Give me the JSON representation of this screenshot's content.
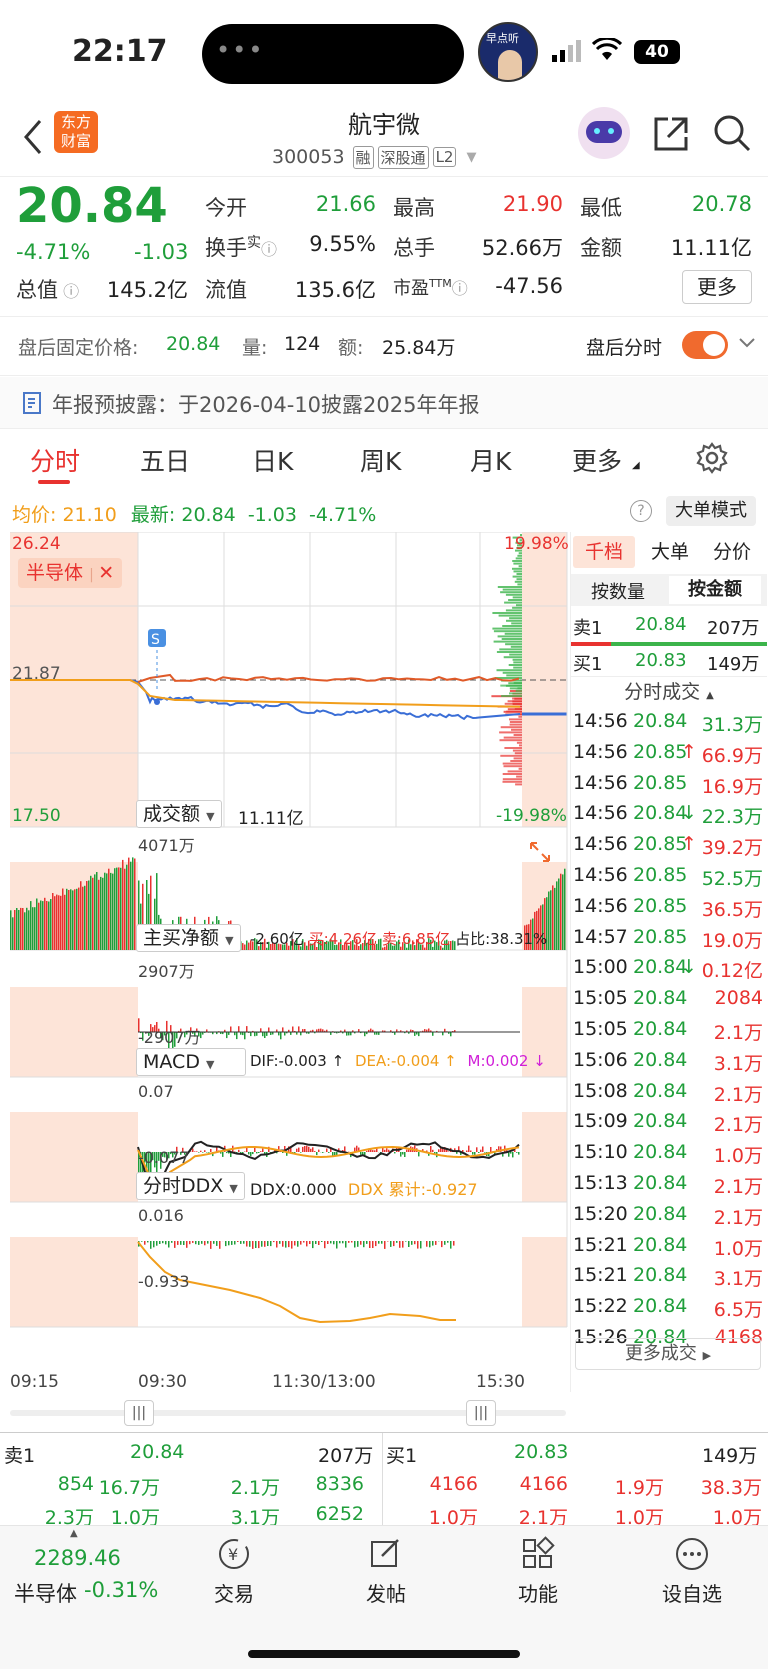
{
  "status": {
    "time": "22:17",
    "battery": "40",
    "listen_badge": "早点听"
  },
  "header": {
    "title": "航宇微",
    "code": "300053",
    "tags": [
      "融",
      "深股通",
      "L2"
    ],
    "logo_line1": "东方",
    "logo_line2": "财富"
  },
  "quote": {
    "price": "20.84",
    "change_pct": "-4.71%",
    "change": "-1.03",
    "open_label": "今开",
    "open": "21.66",
    "high_label": "最高",
    "high": "21.90",
    "low_label": "最低",
    "low": "20.78",
    "turnover_label": "换手",
    "turnover_sup": "实",
    "turnover": "9.55%",
    "volume_label": "总手",
    "volume": "52.66万",
    "amount_label": "金额",
    "amount": "11.11亿",
    "mktcap_label": "总值",
    "mktcap": "145.2亿",
    "float_label": "流值",
    "float": "135.6亿",
    "pe_label": "市盈",
    "pe_sup": "TTM",
    "pe": "-47.56",
    "more": "更多"
  },
  "after": {
    "price_label": "盘后固定价格:",
    "price": "20.84",
    "vol_label": "量:",
    "vol": "124",
    "amt_label": "额:",
    "amt": "25.84万",
    "toggle_label": "盘后分时"
  },
  "notice": {
    "text": "年报预披露：于2026-04-10披露2025年年报"
  },
  "tabs": [
    "分时",
    "五日",
    "日K",
    "周K",
    "月K",
    "更多"
  ],
  "chart": {
    "avg_label": "均价:",
    "avg": "21.10",
    "latest_label": "最新:",
    "latest": "20.84",
    "chg": "-1.03",
    "pct": "-4.71%",
    "big_mode": "大单模式",
    "y_top": "26.24",
    "y_mid": "21.87",
    "y_bot": "17.50",
    "pct_top": "19.98%",
    "pct_bot": "-19.98%",
    "sector_tag": "半导体",
    "vol_label": "成交额",
    "vol_total": "11.11亿",
    "vol_max": "4071万",
    "net_label": "主买净额",
    "net_value": "-2.60亿",
    "net_buy": "买:4.26亿",
    "net_sell": "卖:6.85亿",
    "net_ratio": "占比:38.31%",
    "net_top": "2907万",
    "net_bot": "-2907万",
    "macd_label": "MACD",
    "dif": "DIF:-0.003 ↑",
    "dea": "DEA:-0.004 ↑",
    "m": "M:0.002 ↓",
    "macd_top": "0.07",
    "macd_bot": "-0.077",
    "ddx_label": "分时DDX",
    "ddx": "DDX:0.000",
    "ddx_cum": "DDX 累计:-0.927",
    "ddx_top": "0.016",
    "ddx_bot": "-0.933",
    "x_labels": [
      "09:15",
      "09:30",
      "11:30/13:00",
      "15:30"
    ]
  },
  "right": {
    "tabs": [
      "千档",
      "大单",
      "分价"
    ],
    "sub": [
      "按数量",
      "按金额"
    ],
    "sell1_label": "卖1",
    "sell1_price": "20.84",
    "sell1_amt": "207万",
    "buy1_label": "买1",
    "buy1_price": "20.83",
    "buy1_amt": "149万",
    "trades_title": "分时成交",
    "more": "更多成交",
    "trades": [
      [
        "14:56",
        "20.84",
        "",
        "31.3万",
        "g"
      ],
      [
        "14:56",
        "20.85",
        "↑",
        "66.9万",
        "r"
      ],
      [
        "14:56",
        "20.85",
        "",
        "16.9万",
        "r"
      ],
      [
        "14:56",
        "20.84",
        "↓",
        "22.3万",
        "g"
      ],
      [
        "14:56",
        "20.85",
        "↑",
        "39.2万",
        "r"
      ],
      [
        "14:56",
        "20.85",
        "",
        "52.5万",
        "g"
      ],
      [
        "14:56",
        "20.85",
        "",
        "36.5万",
        "r"
      ],
      [
        "14:57",
        "20.85",
        "",
        "19.0万",
        "r"
      ],
      [
        "15:00",
        "20.84",
        "↓",
        "0.12亿",
        "r"
      ],
      [
        "15:05",
        "20.84",
        "",
        "2084",
        "r"
      ],
      [
        "15:05",
        "20.84",
        "",
        "2.1万",
        "r"
      ],
      [
        "15:06",
        "20.84",
        "",
        "3.1万",
        "r"
      ],
      [
        "15:08",
        "20.84",
        "",
        "2.1万",
        "r"
      ],
      [
        "15:09",
        "20.84",
        "",
        "2.1万",
        "r"
      ],
      [
        "15:10",
        "20.84",
        "",
        "1.0万",
        "r"
      ],
      [
        "15:13",
        "20.84",
        "",
        "2.1万",
        "r"
      ],
      [
        "15:20",
        "20.84",
        "",
        "2.1万",
        "r"
      ],
      [
        "15:21",
        "20.84",
        "",
        "1.0万",
        "r"
      ],
      [
        "15:21",
        "20.84",
        "",
        "3.1万",
        "r"
      ],
      [
        "15:22",
        "20.84",
        "",
        "6.5万",
        "r"
      ],
      [
        "15:26",
        "20.84",
        "",
        "4168",
        "r"
      ]
    ]
  },
  "orderbook": {
    "sell_label": "卖1",
    "sell_price": "20.84",
    "sell_amt": "207万",
    "buy_label": "买1",
    "buy_price": "20.83",
    "buy_amt": "149万",
    "sell_r1": [
      "854",
      "16.7万",
      "2.1万",
      "8336"
    ],
    "sell_r2": [
      "2.3万",
      "1.0万",
      "3.1万",
      "6252"
    ],
    "buy_r1": [
      "4166",
      "4166",
      "1.9万",
      "38.3万"
    ],
    "buy_r2": [
      "1.0万",
      "2.1万",
      "1.0万",
      "1.0万"
    ]
  },
  "bottom": {
    "index": "2289.46",
    "index_name": "半导体",
    "index_pct": "-0.31%",
    "items": [
      "交易",
      "发帖",
      "功能",
      "设自选"
    ]
  }
}
